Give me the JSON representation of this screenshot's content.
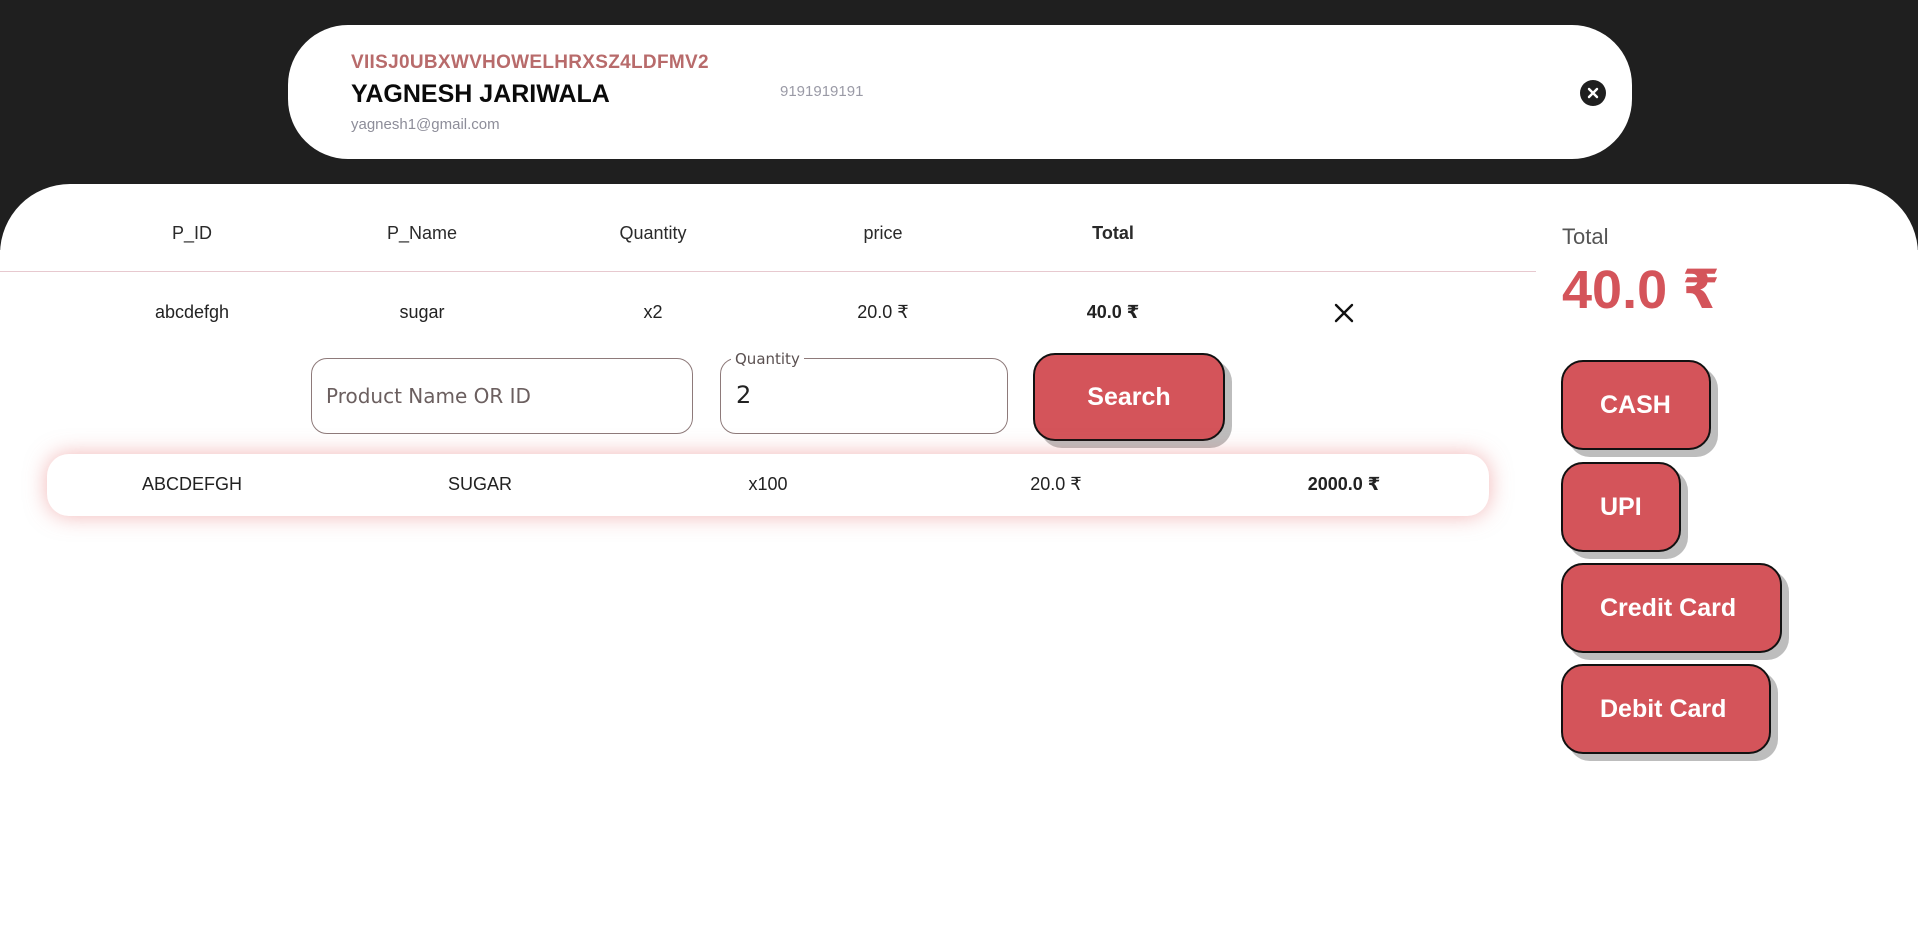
{
  "customer": {
    "id": "VIISJ0UBXWVHOWELHRXSZ4LDFMV2",
    "name": "YAGNESH JARIWALA",
    "email": "yagnesh1@gmail.com",
    "phone": "9191919191"
  },
  "table": {
    "headers": [
      "P_ID",
      "P_Name",
      "Quantity",
      "price",
      "Total"
    ],
    "cart_rows": [
      {
        "p_id": "abcdefgh",
        "p_name": "sugar",
        "quantity": "x2",
        "price": "20.0 ₹",
        "total": "40.0 ₹"
      }
    ]
  },
  "search": {
    "product_placeholder": "Product Name OR ID",
    "quantity_label": "Quantity",
    "quantity_value": "2",
    "button_label": "Search"
  },
  "result": {
    "p_id": "ABCDEFGH",
    "p_name": "SUGAR",
    "quantity": "x100",
    "price": "20.0 ₹",
    "total": "2000.0 ₹"
  },
  "summary": {
    "total_label": "Total",
    "total_amount": "40.0 ₹"
  },
  "payment_methods": [
    "CASH",
    "UPI",
    "Credit Card",
    "Debit Card"
  ],
  "colors": {
    "accent": "#d4545a",
    "header_bg": "#1f1f1f",
    "id_color": "#b86b6b"
  },
  "icons": {
    "close": "close-circle-icon",
    "remove": "remove-x-icon"
  }
}
